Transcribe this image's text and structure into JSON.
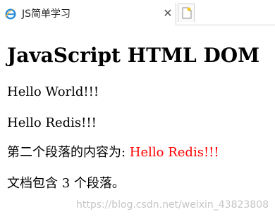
{
  "browser": {
    "tab_title": "JS简单学习",
    "close_glyph": "✕",
    "tab_icon": "ie-icon",
    "new_tab_icon": "new-tab-icon"
  },
  "page": {
    "heading": "JavaScript HTML DOM",
    "paragraphs": [
      "Hello World!!!",
      "Hello Redis!!!"
    ],
    "second_paragraph_prefix": "第二个段落的内容为: ",
    "second_paragraph_value": "Hello Redis!!!",
    "paragraph_count_text": "文档包含 3 个段落。",
    "highlight_color": "#ff0000"
  },
  "watermark": "https://blog.csdn.net/weixin_43823808"
}
